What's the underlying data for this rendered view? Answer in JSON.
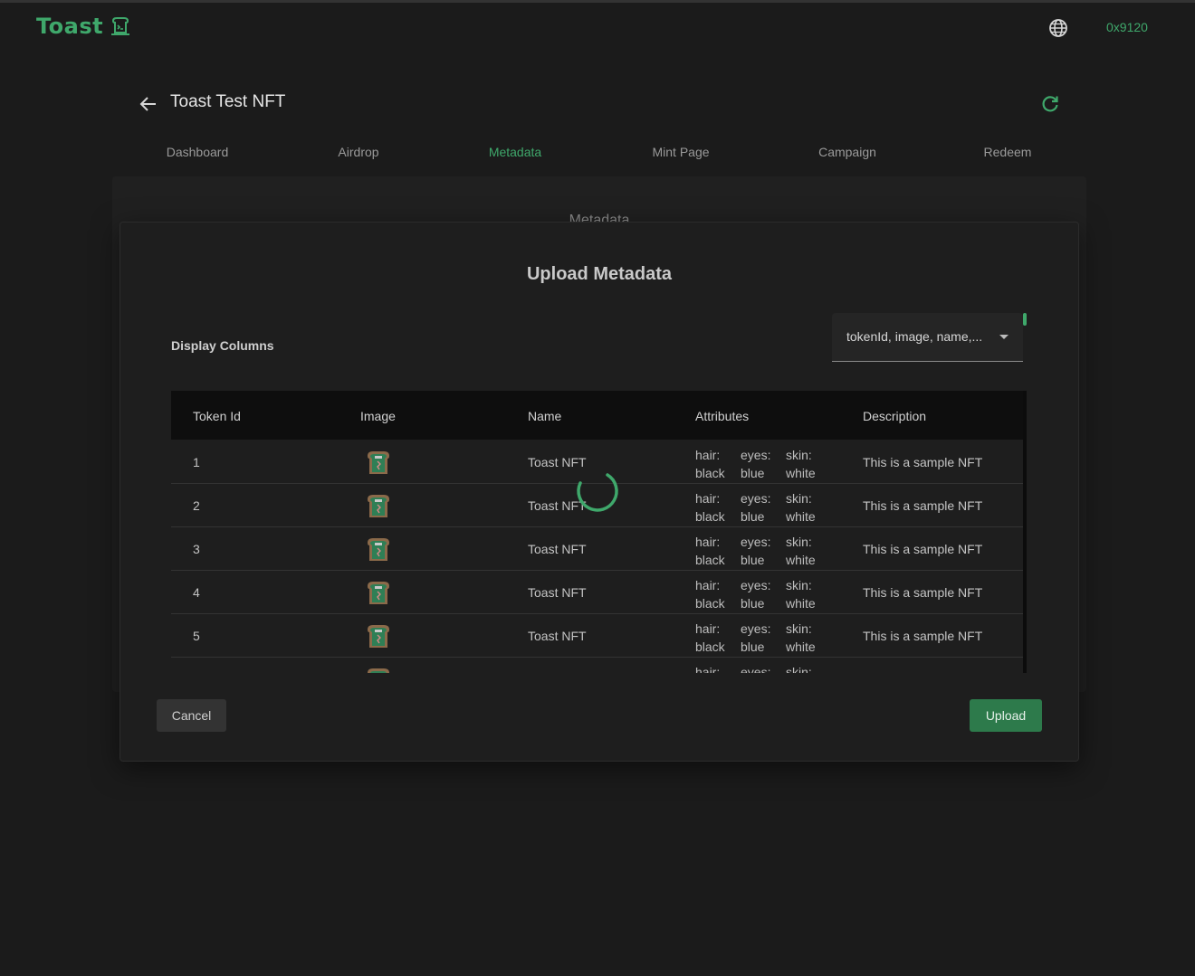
{
  "header": {
    "brand": "Toast",
    "wallet": "0x9120",
    "icons": {
      "brand": "toast-logo-icon",
      "globe": "globe-icon"
    }
  },
  "page": {
    "title": "Toast Test NFT",
    "behind_title": "Metadata",
    "icons": {
      "back": "arrow-left-icon",
      "refresh": "refresh-icon"
    }
  },
  "tabs": [
    {
      "label": "Dashboard",
      "active": false
    },
    {
      "label": "Airdrop",
      "active": false
    },
    {
      "label": "Metadata",
      "active": true
    },
    {
      "label": "Mint Page",
      "active": false
    },
    {
      "label": "Campaign",
      "active": false
    },
    {
      "label": "Redeem",
      "active": false
    }
  ],
  "modal": {
    "title": "Upload Metadata",
    "display_columns_label": "Display Columns",
    "display_columns_value": "tokenId, image, name,...",
    "cancel_label": "Cancel",
    "upload_label": "Upload",
    "loading": true
  },
  "table": {
    "headers": [
      "Token Id",
      "Image",
      "Name",
      "Attributes",
      "Description"
    ],
    "rows": [
      {
        "id": "1",
        "name": "Toast NFT",
        "attrs": [
          [
            "hair:",
            "black"
          ],
          [
            "eyes:",
            "blue"
          ],
          [
            "skin:",
            "white"
          ]
        ],
        "desc": "This is a sample NFT"
      },
      {
        "id": "2",
        "name": "Toast NFT",
        "attrs": [
          [
            "hair:",
            "black"
          ],
          [
            "eyes:",
            "blue"
          ],
          [
            "skin:",
            "white"
          ]
        ],
        "desc": "This is a sample NFT"
      },
      {
        "id": "3",
        "name": "Toast NFT",
        "attrs": [
          [
            "hair:",
            "black"
          ],
          [
            "eyes:",
            "blue"
          ],
          [
            "skin:",
            "white"
          ]
        ],
        "desc": "This is a sample NFT"
      },
      {
        "id": "4",
        "name": "Toast NFT",
        "attrs": [
          [
            "hair:",
            "black"
          ],
          [
            "eyes:",
            "blue"
          ],
          [
            "skin:",
            "white"
          ]
        ],
        "desc": "This is a sample NFT"
      },
      {
        "id": "5",
        "name": "Toast NFT",
        "attrs": [
          [
            "hair:",
            "black"
          ],
          [
            "eyes:",
            "blue"
          ],
          [
            "skin:",
            "white"
          ]
        ],
        "desc": "This is a sample NFT"
      },
      {
        "id": "",
        "name": "",
        "attrs": [
          [
            "hair:",
            ""
          ],
          [
            "eyes:",
            ""
          ],
          [
            "skin:",
            ""
          ]
        ],
        "desc": ""
      }
    ]
  },
  "colors": {
    "accent": "#3fa86b",
    "button_primary": "#2d7a4b",
    "background": "#1b1b1b"
  }
}
